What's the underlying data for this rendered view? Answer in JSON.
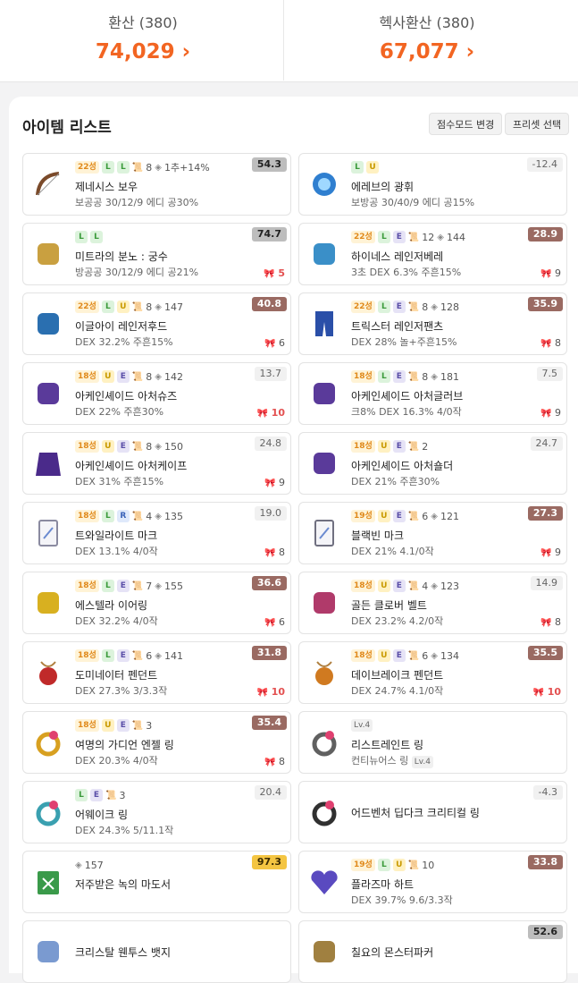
{
  "header": {
    "left": {
      "label": "환산 (380)",
      "value": "74,029"
    },
    "right": {
      "label": "헥사환산 (380)",
      "value": "67,077"
    }
  },
  "panel": {
    "title": "아이템 리스트",
    "btn_score": "점수모드 변경",
    "btn_preset": "프리셋 선택"
  },
  "icons": {
    "chevron": "›",
    "ribbon": "🎀",
    "scroll": "📜",
    "stone": "◈"
  },
  "colors": {
    "accent": "#f26522",
    "score_dark": "#9a6a62",
    "score_gold": "#f4c542"
  },
  "items": [
    {
      "name": "제네시스 보우",
      "star": "22성",
      "badges": [
        "L",
        "L"
      ],
      "upgrades": "8",
      "flame": "1추+14%",
      "stats": "보공공 30/12/9 에디 공30%",
      "score": "54.3",
      "score_style": "grey",
      "cuts": "",
      "icon": "bow-icon",
      "icolor": "#7a4a2a"
    },
    {
      "name": "에레브의 광휘",
      "star": "",
      "badges": [
        "L",
        "U"
      ],
      "upgrades": "",
      "flame": "",
      "stats": "보방공 30/40/9 에디 공15%",
      "score": "-12.4",
      "score_style": "light",
      "cuts": "",
      "icon": "orb-icon",
      "icolor": "#2f7fd0"
    },
    {
      "name": "미트라의 분노 : 궁수",
      "star": "",
      "badges": [
        "L",
        "L"
      ],
      "upgrades": "",
      "flame": "",
      "stats": "방공공 30/12/9 에디 공21%",
      "score": "74.7",
      "score_style": "grey",
      "cuts": "5",
      "cut_hot": true,
      "icon": "emblem-icon",
      "icolor": "#c9a040"
    },
    {
      "name": "하이네스 레인저베레",
      "star": "22성",
      "badges": [
        "L",
        "E"
      ],
      "upgrades": "12",
      "flame": "144",
      "stats": "3초 DEX 6.3% 주흔15%",
      "score": "28.9",
      "score_style": "dark",
      "cuts": "9",
      "icon": "hat-icon",
      "icolor": "#3a8fc8"
    },
    {
      "name": "이글아이 레인저후드",
      "star": "22성",
      "badges": [
        "L",
        "U"
      ],
      "upgrades": "8",
      "flame": "147",
      "stats": "DEX 32.2% 주흔15%",
      "score": "40.8",
      "score_style": "dark",
      "cuts": "6",
      "icon": "top-icon",
      "icolor": "#2a6fb0"
    },
    {
      "name": "트릭스터 레인저팬츠",
      "star": "22성",
      "badges": [
        "L",
        "E"
      ],
      "upgrades": "8",
      "flame": "128",
      "stats": "DEX 28% 놀+주흔15%",
      "score": "35.9",
      "score_style": "dark",
      "cuts": "8",
      "icon": "pants-icon",
      "icolor": "#2a4fa8"
    },
    {
      "name": "아케인셰이드 아처슈즈",
      "star": "18성",
      "badges": [
        "U",
        "E"
      ],
      "upgrades": "8",
      "flame": "142",
      "stats": "DEX 22% 주흔30%",
      "score": "13.7",
      "score_style": "light",
      "cuts": "10",
      "cut_hot": true,
      "icon": "shoes-icon",
      "icolor": "#5a3a9a"
    },
    {
      "name": "아케인셰이드 아처글러브",
      "star": "18성",
      "badges": [
        "L",
        "E"
      ],
      "upgrades": "8",
      "flame": "181",
      "stats": "크8% DEX 16.3% 4/0작",
      "score": "7.5",
      "score_style": "light",
      "cuts": "9",
      "icon": "glove-icon",
      "icolor": "#5a3a9a"
    },
    {
      "name": "아케인셰이드 아처케이프",
      "star": "18성",
      "badges": [
        "U",
        "E"
      ],
      "upgrades": "8",
      "flame": "150",
      "stats": "DEX 31% 주흔15%",
      "score": "24.8",
      "score_style": "light",
      "cuts": "9",
      "icon": "cape-icon",
      "icolor": "#4a2a8a"
    },
    {
      "name": "아케인셰이드 아처숄더",
      "star": "18성",
      "badges": [
        "U",
        "E"
      ],
      "upgrades": "",
      "flame": "",
      "scroll_count": "2",
      "stats": "DEX 21% 주흔30%",
      "score": "24.7",
      "score_style": "light",
      "cuts": "",
      "icon": "shoulder-icon",
      "icolor": "#5a3a9a"
    },
    {
      "name": "트와일라이트 마크",
      "star": "18성",
      "badges": [
        "L",
        "R"
      ],
      "upgrades": "4",
      "flame": "135",
      "stats": "DEX 13.1% 4/0작",
      "score": "19.0",
      "score_style": "light",
      "cuts": "8",
      "icon": "mark-icon",
      "icolor": "#8a8aa0"
    },
    {
      "name": "블랙빈 마크",
      "star": "19성",
      "badges": [
        "U",
        "E"
      ],
      "upgrades": "6",
      "flame": "121",
      "stats": "DEX 21% 4.1/0작",
      "score": "27.3",
      "score_style": "dark",
      "cuts": "9",
      "icon": "mark-icon",
      "icolor": "#707080"
    },
    {
      "name": "에스텔라 이어링",
      "star": "18성",
      "badges": [
        "L",
        "E"
      ],
      "upgrades": "7",
      "flame": "155",
      "stats": "DEX 32.2% 4/0작",
      "score": "36.6",
      "score_style": "dark",
      "cuts": "6",
      "icon": "earring-icon",
      "icolor": "#d8b020"
    },
    {
      "name": "골든 클로버 벨트",
      "star": "18성",
      "badges": [
        "U",
        "E"
      ],
      "upgrades": "4",
      "flame": "123",
      "stats": "DEX 23.2% 4.2/0작",
      "score": "14.9",
      "score_style": "light",
      "cuts": "8",
      "icon": "belt-icon",
      "icolor": "#b03a6a"
    },
    {
      "name": "도미네이터 펜던트",
      "star": "18성",
      "badges": [
        "L",
        "E"
      ],
      "upgrades": "6",
      "flame": "141",
      "stats": "DEX 27.3% 3/3.3작",
      "score": "31.8",
      "score_style": "dark",
      "cuts": "10",
      "cut_hot": true,
      "icon": "pendant-icon",
      "icolor": "#c02a2a"
    },
    {
      "name": "데이브레이크 펜던트",
      "star": "18성",
      "badges": [
        "U",
        "E"
      ],
      "upgrades": "6",
      "flame": "134",
      "stats": "DEX 24.7% 4.1/0작",
      "score": "35.5",
      "score_style": "dark",
      "cuts": "10",
      "cut_hot": true,
      "icon": "pendant-icon",
      "icolor": "#d07a20"
    },
    {
      "name": "여명의 가디언 엔젤 링",
      "star": "18성",
      "badges": [
        "U",
        "E"
      ],
      "upgrades": "",
      "flame": "",
      "scroll_count": "3",
      "stats": "DEX 20.3% 4/0작",
      "score": "35.4",
      "score_style": "dark",
      "cuts": "8",
      "icon": "ring-icon",
      "icolor": "#d8a020"
    },
    {
      "name": "리스트레인트 링",
      "star": "",
      "badges": [],
      "level": "Lv.4",
      "upgrades": "",
      "flame": "",
      "stats": "컨티뉴어스 링",
      "stats_level": "Lv.4",
      "score": "",
      "score_style": "light",
      "cuts": "",
      "icon": "ring-icon",
      "icolor": "#606060"
    },
    {
      "name": "어웨이크 링",
      "star": "",
      "badges": [
        "L",
        "E"
      ],
      "upgrades": "",
      "flame": "",
      "scroll_count": "3",
      "stats": "DEX 24.3% 5/11.1작",
      "score": "20.4",
      "score_style": "light",
      "cuts": "",
      "icon": "ring-icon",
      "icolor": "#3aa0b0"
    },
    {
      "name": "어드벤처 딥다크 크리티컬 링",
      "star": "",
      "badges": [],
      "upgrades": "",
      "flame": "",
      "stats": "",
      "score": "-4.3",
      "score_style": "light",
      "cuts": "",
      "icon": "ring-icon",
      "icolor": "#303030"
    },
    {
      "name": "저주받은 녹의 마도서",
      "star": "",
      "badges": [],
      "upgrades": "",
      "flame": "157",
      "stats": "",
      "score": "97.3",
      "score_style": "gold",
      "cuts": "",
      "icon": "book-icon",
      "icolor": "#3a9a4a"
    },
    {
      "name": "플라즈마 하트",
      "star": "19성",
      "badges": [
        "L",
        "U"
      ],
      "upgrades": "10",
      "flame": "",
      "stats": "DEX 39.7% 9.6/3.3작",
      "score": "33.8",
      "score_style": "dark",
      "cuts": "",
      "icon": "heart-icon",
      "icolor": "#5a4ac0"
    },
    {
      "name": "크리스탈 웬투스 뱃지",
      "star": "",
      "badges": [],
      "upgrades": "",
      "flame": "",
      "stats": "",
      "score": "",
      "score_style": "light",
      "cuts": "",
      "icon": "badge-icon",
      "icolor": "#7a9ad0"
    },
    {
      "name": "칠요의 몬스터파커",
      "star": "",
      "badges": [],
      "upgrades": "",
      "flame": "",
      "stats": "",
      "score": "52.6",
      "score_style": "grey",
      "cuts": "",
      "icon": "medal-icon",
      "icolor": "#a08040"
    }
  ]
}
